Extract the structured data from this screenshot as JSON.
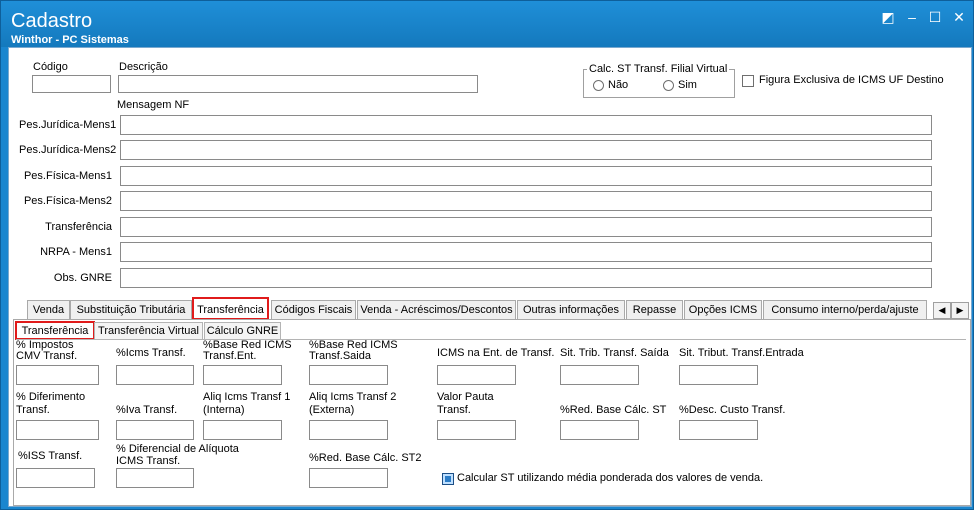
{
  "window": {
    "title": "Cadastro",
    "subtitle": "Winthor - PC Sistemas",
    "buttons": [
      "◩",
      "–",
      "☐",
      "✕"
    ]
  },
  "header": {
    "codigo_label": "Código",
    "descricao_label": "Descrição",
    "calc_st_title": "Calc. ST Transf. Filial Virtual",
    "radio_nao": "Não",
    "radio_sim": "Sim",
    "figura_label": "Figura Exclusiva de ICMS UF Destino",
    "mensagem_label": "Mensagem NF"
  },
  "messages": [
    {
      "label": "Pes.Jurídica-Mens1",
      "value": ""
    },
    {
      "label": "Pes.Jurídica-Mens2",
      "value": ""
    },
    {
      "label": "Pes.Física-Mens1",
      "value": ""
    },
    {
      "label": "Pes.Física-Mens2",
      "value": ""
    },
    {
      "label": "Transferência",
      "value": ""
    },
    {
      "label": "NRPA - Mens1",
      "value": ""
    },
    {
      "label": "Obs. GNRE",
      "value": ""
    }
  ],
  "tabs": [
    "Venda",
    "Substituição Tributária",
    "Transferência",
    "Códigos Fiscais",
    "Venda - Acréscimos/Descontos",
    "Outras informações",
    "Repasse",
    "Opções ICMS",
    "Consumo interno/perda/ajuste"
  ],
  "tab_scroll": [
    "◀",
    "▶"
  ],
  "subtabs": [
    "Transferência",
    "Transferência Virtual",
    "Cálculo GNRE"
  ],
  "fields": {
    "impostos_cmv": "% Impostos\nCMV Transf.",
    "icms_transf": "%Icms Transf.",
    "base_red_ent": "%Base Red ICMS\nTransf.Ent.",
    "base_red_saida": "%Base Red ICMS\nTransf.Saida",
    "icms_ent": "ICMS na Ent. de Transf.",
    "sit_trib_saida": "Sit. Trib. Transf. Saída",
    "sit_trib_entrada": "Sit. Tribut. Transf.Entrada",
    "diferimento": "% Diferimento\nTransf.",
    "iva_transf": "%Iva Transf.",
    "aliq_1": "Aliq Icms Transf 1\n(Interna)",
    "aliq_2": "Aliq Icms Transf 2\n(Externa)",
    "valor_pauta": "Valor Pauta\nTransf.",
    "red_base_st": "%Red. Base Cálc. ST",
    "desc_custo": "%Desc. Custo Transf.",
    "iss_transf": "%ISS  Transf.",
    "dif_aliquota": "% Diferencial de Alíquota\nICMS Transf.",
    "red_base_st2": "%Red. Base Cálc. ST2",
    "calc_st_media": "Calcular ST utilizando média ponderada dos valores de venda."
  }
}
